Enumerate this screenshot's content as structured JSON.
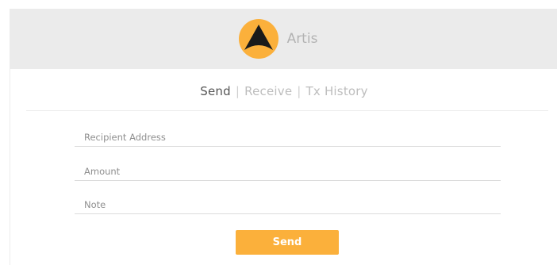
{
  "header": {
    "brand_name": "Artis",
    "logo_icon": "artis-logo-icon"
  },
  "nav": {
    "tabs": [
      {
        "label": "Send",
        "active": true
      },
      {
        "label": "Receive",
        "active": false
      },
      {
        "label": "Tx History",
        "active": false
      }
    ],
    "separator": "|"
  },
  "form": {
    "recipient_placeholder": "Recipient Address",
    "amount_placeholder": "Amount",
    "note_placeholder": "Note",
    "recipient_value": "",
    "amount_value": "",
    "note_value": "",
    "send_label": "Send"
  },
  "colors": {
    "accent": "#fbb03b",
    "header_bg": "#ebebeb",
    "logo_dark": "#1a1a1a"
  }
}
